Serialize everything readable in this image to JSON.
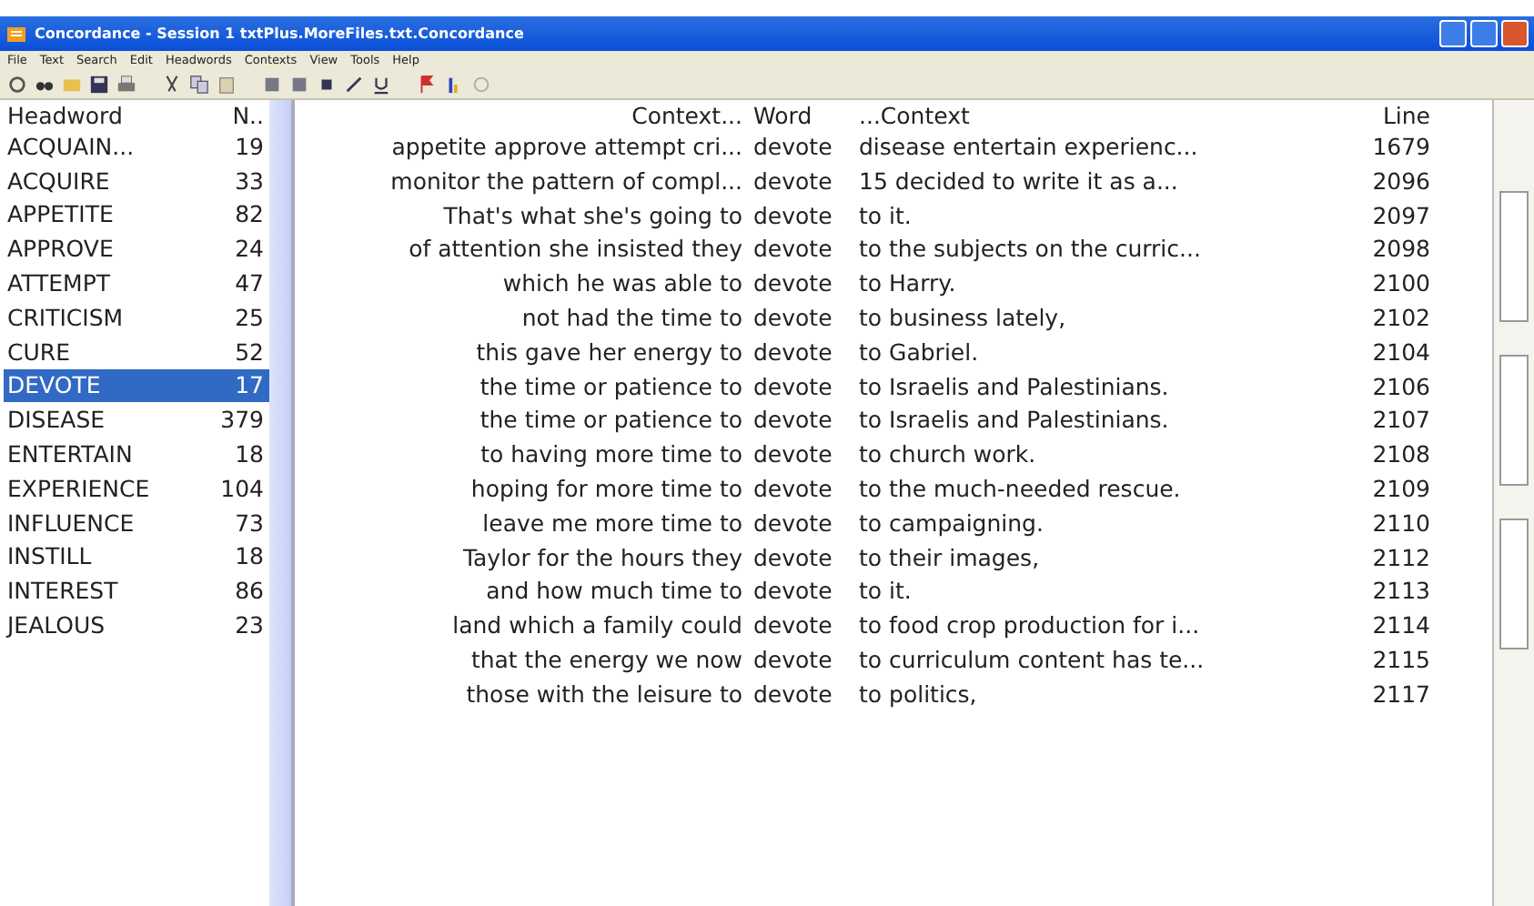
{
  "window": {
    "title": "Concordance - Session 1 txtPlus.MoreFiles.txt.Concordance"
  },
  "menu": [
    "File",
    "Text",
    "Search",
    "Edit",
    "Headwords",
    "Contexts",
    "View",
    "Tools",
    "Help"
  ],
  "headwords": {
    "columns": [
      "Headword",
      "N.."
    ],
    "rows": [
      {
        "word": "ACQUAIN...",
        "count": "19",
        "selected": false
      },
      {
        "word": "ACQUIRE",
        "count": "33",
        "selected": false
      },
      {
        "word": "APPETITE",
        "count": "82",
        "selected": false
      },
      {
        "word": "APPROVE",
        "count": "24",
        "selected": false
      },
      {
        "word": "ATTEMPT",
        "count": "47",
        "selected": false
      },
      {
        "word": "CRITICISM",
        "count": "25",
        "selected": false
      },
      {
        "word": "CURE",
        "count": "52",
        "selected": false
      },
      {
        "word": "DEVOTE",
        "count": "17",
        "selected": true
      },
      {
        "word": "DISEASE",
        "count": "379",
        "selected": false
      },
      {
        "word": "ENTERTAIN",
        "count": "18",
        "selected": false
      },
      {
        "word": "EXPERIENCE",
        "count": "104",
        "selected": false
      },
      {
        "word": "INFLUENCE",
        "count": "73",
        "selected": false
      },
      {
        "word": "INSTILL",
        "count": "18",
        "selected": false
      },
      {
        "word": "INTEREST",
        "count": "86",
        "selected": false
      },
      {
        "word": "JEALOUS",
        "count": "23",
        "selected": false
      }
    ]
  },
  "concordance": {
    "columns": [
      "Context...",
      "Word",
      "...Context",
      "Line"
    ],
    "rows": [
      {
        "left": "appetite approve attempt cri...",
        "word": "devote",
        "right": "disease entertain experienc...",
        "line": "1679"
      },
      {
        "left": "monitor the pattern of compl...",
        "word": "devote",
        "right": "15  decided to write it as a...",
        "line": "2096"
      },
      {
        "left": "That's what she's going to",
        "word": "devote",
        "right": "to it.",
        "line": "2097"
      },
      {
        "left": "of attention she insisted they",
        "word": "devote",
        "right": "to the subjects on the curric...",
        "line": "2098"
      },
      {
        "left": "which he was able to",
        "word": "devote",
        "right": "to Harry.",
        "line": "2100"
      },
      {
        "left": "not had the time to",
        "word": "devote",
        "right": "to business lately,",
        "line": "2102"
      },
      {
        "left": "this gave her energy to",
        "word": "devote",
        "right": "to Gabriel.",
        "line": "2104"
      },
      {
        "left": "the time or patience to",
        "word": "devote",
        "right": "to Israelis and Palestinians.",
        "line": "2106"
      },
      {
        "left": "the time or patience to",
        "word": "devote",
        "right": "to Israelis and Palestinians.",
        "line": "2107"
      },
      {
        "left": "to having more time to",
        "word": "devote",
        "right": "to church work.",
        "line": "2108"
      },
      {
        "left": "hoping for more time to",
        "word": "devote",
        "right": "to the much-needed rescue.",
        "line": "2109"
      },
      {
        "left": "leave me more time to",
        "word": "devote",
        "right": "to campaigning.",
        "line": "2110"
      },
      {
        "left": "Taylor for the hours they",
        "word": "devote",
        "right": "to their images,",
        "line": "2112"
      },
      {
        "left": "and how much time to",
        "word": "devote",
        "right": "to it.",
        "line": "2113"
      },
      {
        "left": "land which a family could",
        "word": "devote",
        "right": "to food crop production for i...",
        "line": "2114"
      },
      {
        "left": "that the energy we now",
        "word": "devote",
        "right": "to curriculum content has te...",
        "line": "2115"
      },
      {
        "left": "those with the leisure to",
        "word": "devote",
        "right": "to politics,",
        "line": "2117"
      }
    ]
  }
}
